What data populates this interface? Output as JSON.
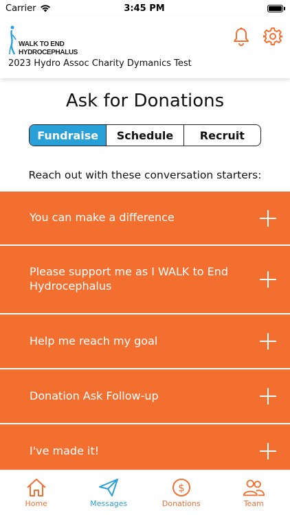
{
  "status_bar": {
    "carrier": "Carrier",
    "time": "3:45 PM"
  },
  "header": {
    "logo_line1": "WALK TO END",
    "logo_line2": "HYDROCEPHALUS",
    "event_name": "2023 Hydro Assoc Charity Dymanics Test",
    "icons": [
      "bell-icon",
      "gear-icon"
    ]
  },
  "main": {
    "title": "Ask for Donations",
    "tabs": [
      {
        "label": "Fundraise",
        "active": true
      },
      {
        "label": "Schedule",
        "active": false
      },
      {
        "label": "Recruit",
        "active": false
      }
    ],
    "subtitle": "Reach out with these conversation starters:",
    "starters": [
      "You can make a difference",
      "Please support me as I WALK to End Hydrocephalus",
      "Help me reach my goal",
      "Donation Ask Follow-up",
      "I've made it!"
    ]
  },
  "tabbar": {
    "items": [
      {
        "label": "Home",
        "icon": "home-icon",
        "active": false
      },
      {
        "label": "Messages",
        "icon": "paper-plane-icon",
        "active": true
      },
      {
        "label": "Donations",
        "icon": "dollar-circle-icon",
        "active": false
      },
      {
        "label": "Team",
        "icon": "team-icon",
        "active": false
      }
    ]
  },
  "colors": {
    "accent_orange": "#f26f2f",
    "segment_active": "#2aa0d8",
    "tab_active": "#2aa0d8",
    "tab_inactive": "#f26f2f",
    "logo_blue": "#2aa0d8"
  }
}
